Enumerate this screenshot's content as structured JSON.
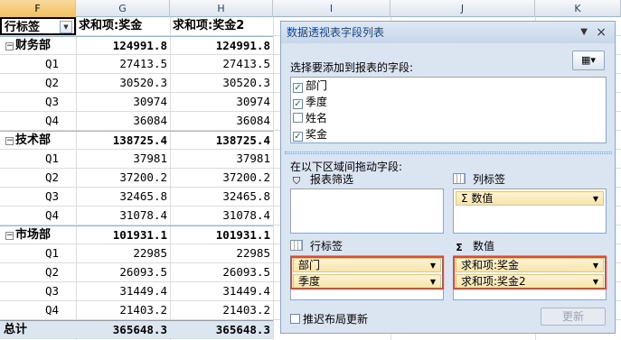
{
  "columns": [
    "F",
    "G",
    "H",
    "I",
    "J",
    "K"
  ],
  "pivot": {
    "header": {
      "row_label": "行标签",
      "sum1": "求和项:奖金",
      "sum2": "求和项:奖金2"
    },
    "groups": [
      {
        "name": "财务部",
        "total1": "124991.8",
        "total2": "124991.8",
        "rows": [
          {
            "q": "Q1",
            "v1": "27413.5",
            "v2": "27413.5"
          },
          {
            "q": "Q2",
            "v1": "30520.3",
            "v2": "30520.3"
          },
          {
            "q": "Q3",
            "v1": "30974",
            "v2": "30974"
          },
          {
            "q": "Q4",
            "v1": "36084",
            "v2": "36084"
          }
        ]
      },
      {
        "name": "技术部",
        "total1": "138725.4",
        "total2": "138725.4",
        "rows": [
          {
            "q": "Q1",
            "v1": "37981",
            "v2": "37981"
          },
          {
            "q": "Q2",
            "v1": "37200.2",
            "v2": "37200.2"
          },
          {
            "q": "Q3",
            "v1": "32465.8",
            "v2": "32465.8"
          },
          {
            "q": "Q4",
            "v1": "31078.4",
            "v2": "31078.4"
          }
        ]
      },
      {
        "name": "市场部",
        "total1": "101931.1",
        "total2": "101931.1",
        "rows": [
          {
            "q": "Q1",
            "v1": "22985",
            "v2": "22985"
          },
          {
            "q": "Q2",
            "v1": "26093.5",
            "v2": "26093.5"
          },
          {
            "q": "Q3",
            "v1": "31449.4",
            "v2": "31449.4"
          },
          {
            "q": "Q4",
            "v1": "21403.2",
            "v2": "21403.2"
          }
        ]
      }
    ],
    "grand_total": {
      "label": "总计",
      "v1": "365648.3",
      "v2": "365648.3"
    }
  },
  "field_list": {
    "title": "数据透视表字段列表",
    "choose_label": "选择要添加到报表的字段:",
    "fields": [
      {
        "name": "部门",
        "checked": true
      },
      {
        "name": "季度",
        "checked": true
      },
      {
        "name": "姓名",
        "checked": false
      },
      {
        "name": "奖金",
        "checked": true
      }
    ],
    "drag_label": "在以下区域间拖动字段:",
    "areas": {
      "filter": {
        "title": "报表筛选",
        "items": []
      },
      "columns": {
        "title": "列标签",
        "items": [
          "Σ 数值"
        ]
      },
      "rows": {
        "title": "行标签",
        "items": [
          "部门",
          "季度"
        ]
      },
      "values": {
        "title": "数值",
        "items": [
          "求和项:奖金",
          "求和项:奖金2"
        ]
      }
    },
    "defer_label": "推迟布局更新",
    "update_button": "更新"
  }
}
